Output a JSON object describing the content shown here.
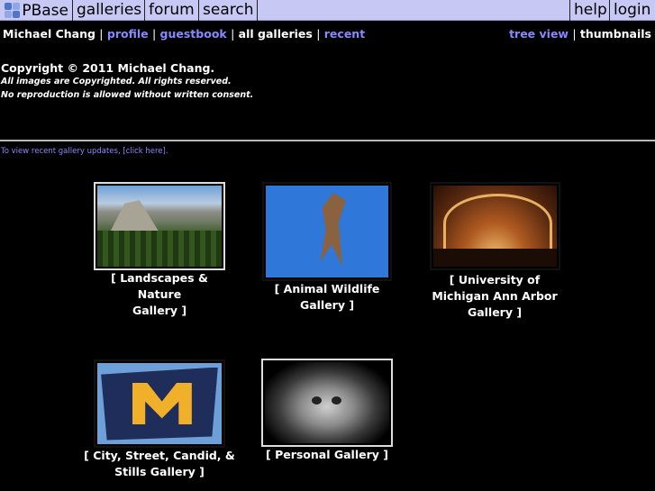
{
  "nav": {
    "brand": "PBase",
    "items": [
      "galleries",
      "forum",
      "search"
    ],
    "right_items": [
      "help",
      "login"
    ]
  },
  "userline": {
    "name": "Michael Chang",
    "sep": "|",
    "profile": "profile",
    "guestbook": "guestbook",
    "all_galleries": "all galleries",
    "recent": "recent"
  },
  "views": {
    "tree_view": "tree view",
    "sep": "|",
    "thumbnails": "thumbnails"
  },
  "copyright": {
    "line1": "Copyright © 2011 Michael Chang.",
    "line2": "All images are Copyrighted. All rights reserved.",
    "line3": "No reproduction is allowed without written consent."
  },
  "recent_updates": "To view recent gallery updates, [click here].",
  "galleries": [
    {
      "caption_line1": "[ Landscapes & Nature",
      "caption_line2": "Gallery ]",
      "caption_line3": ""
    },
    {
      "caption_line1": "[ Animal Wildlife",
      "caption_line2": "Gallery ]",
      "caption_line3": ""
    },
    {
      "caption_line1": "[ University of",
      "caption_line2": "Michigan Ann Arbor",
      "caption_line3": "Gallery ]"
    },
    {
      "caption_line1": "[ City, Street, Candid, &",
      "caption_line2": "Stills Gallery ]",
      "caption_line3": ""
    },
    {
      "caption_line1": "[ Personal Gallery ]",
      "caption_line2": "",
      "caption_line3": ""
    }
  ],
  "colors": {
    "nav_bg": "#c8c8f4",
    "link": "#8888ff",
    "background": "#000000"
  }
}
